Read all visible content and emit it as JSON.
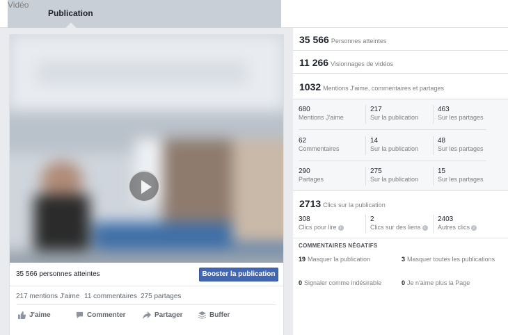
{
  "tabs": {
    "video": "Vidéo",
    "publication": "Publication"
  },
  "post": {
    "reach_text": "35 566 personnes atteintes",
    "boost_label": "Booster la publication",
    "likes": "217 mentions J'aime",
    "comments": "11 commentaires",
    "shares": "275 partages",
    "actions": {
      "like": "J'aime",
      "comment": "Commenter",
      "share": "Partager",
      "buffer": "Buffer"
    }
  },
  "stats": {
    "reach": {
      "value": "35 566",
      "label": "Personnes atteintes"
    },
    "views": {
      "value": "11 266",
      "label": "Visionnages de vidéos"
    },
    "reactions": {
      "value": "1032",
      "label": "Mentions J'aime, commentaires et partages"
    },
    "grid": [
      [
        {
          "value": "680",
          "label": "Mentions J'aime"
        },
        {
          "value": "217",
          "label": "Sur la publication"
        },
        {
          "value": "463",
          "label": "Sur les partages"
        }
      ],
      [
        {
          "value": "62",
          "label": "Commentaires"
        },
        {
          "value": "14",
          "label": "Sur la publication"
        },
        {
          "value": "48",
          "label": "Sur les partages"
        }
      ],
      [
        {
          "value": "290",
          "label": "Partages"
        },
        {
          "value": "275",
          "label": "Sur la publication"
        },
        {
          "value": "15",
          "label": "Sur les partages"
        }
      ]
    ],
    "clicks": {
      "value": "2713",
      "label": "Clics sur la publication"
    },
    "clicks_detail": [
      {
        "value": "308",
        "label": "Clics pour lire"
      },
      {
        "value": "2",
        "label": "Clics sur des liens"
      },
      {
        "value": "2403",
        "label": "Autres clics"
      }
    ],
    "negative": {
      "title": "COMMENTAIRES NÉGATIFS",
      "hide_post": {
        "value": "19",
        "label": "Masquer la publication"
      },
      "hide_all": {
        "value": "3",
        "label": "Masquer toutes les publications"
      },
      "spam": {
        "value": "0",
        "label": "Signaler comme indésirable"
      },
      "unlike": {
        "value": "0",
        "label": "Je n'aime plus la Page"
      }
    }
  },
  "icons": {
    "play": "play-icon",
    "like": "thumbs-up-icon",
    "comment": "comment-icon",
    "share": "share-arrow-icon",
    "buffer": "buffer-icon",
    "info": "info-icon"
  },
  "colors": {
    "boost": "#4267b2",
    "panel_bg": "#e9ebee",
    "stats_grey": "#f6f7f9"
  }
}
